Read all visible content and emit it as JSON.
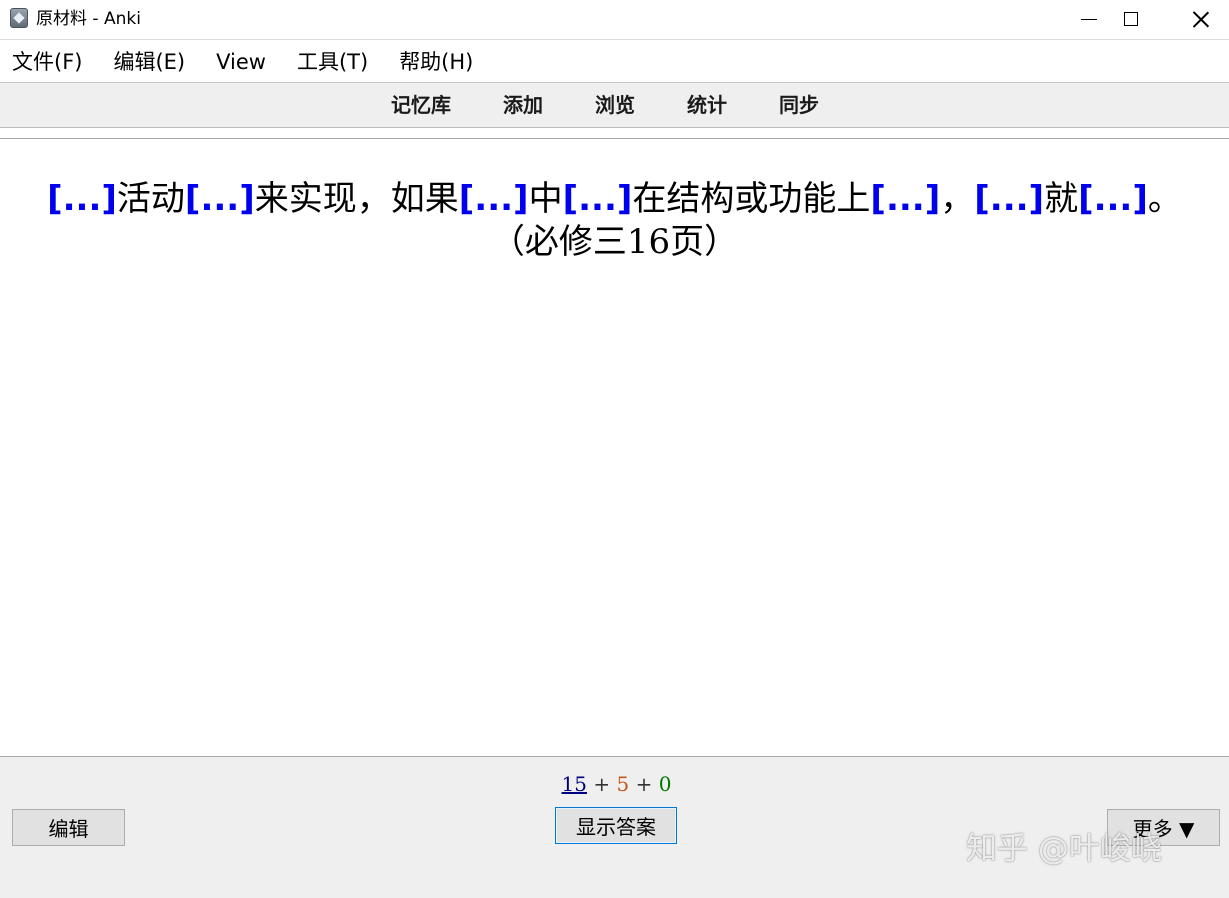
{
  "window": {
    "title": "原材料 - Anki",
    "icon": "anki-app-icon"
  },
  "menu": {
    "items": [
      "文件(F)",
      "编辑(E)",
      "View",
      "工具(T)",
      "帮助(H)"
    ]
  },
  "toolbar": {
    "links": [
      "记忆库",
      "添加",
      "浏览",
      "统计",
      "同步"
    ]
  },
  "card": {
    "segments": [
      {
        "text": "[...]",
        "cloze": true
      },
      {
        "text": "活动",
        "cloze": false
      },
      {
        "text": "[...]",
        "cloze": true
      },
      {
        "text": "来实现，如果",
        "cloze": false
      },
      {
        "text": "[...]",
        "cloze": true
      },
      {
        "text": "中",
        "cloze": false
      },
      {
        "text": "[...]",
        "cloze": true
      },
      {
        "text": "在结构或功能上",
        "cloze": false
      },
      {
        "text": "[...]",
        "cloze": true
      },
      {
        "text": "，",
        "cloze": false
      },
      {
        "text": "[...]",
        "cloze": true
      },
      {
        "text": "就",
        "cloze": false
      },
      {
        "text": "[...]",
        "cloze": true
      },
      {
        "text": "。",
        "cloze": false
      }
    ],
    "source_note": "（必修三16页）",
    "cloze_color": "#0000ee"
  },
  "bottom": {
    "counts": {
      "new": "15",
      "learning": "5",
      "review": "0",
      "separator": "+",
      "colors": {
        "new": "#000080",
        "learning": "#c35617",
        "review": "#007700"
      }
    },
    "edit_label": "编辑",
    "show_answer_label": "显示答案",
    "more_label": "更多 ▼"
  },
  "watermark": "知乎 @叶峻峣"
}
